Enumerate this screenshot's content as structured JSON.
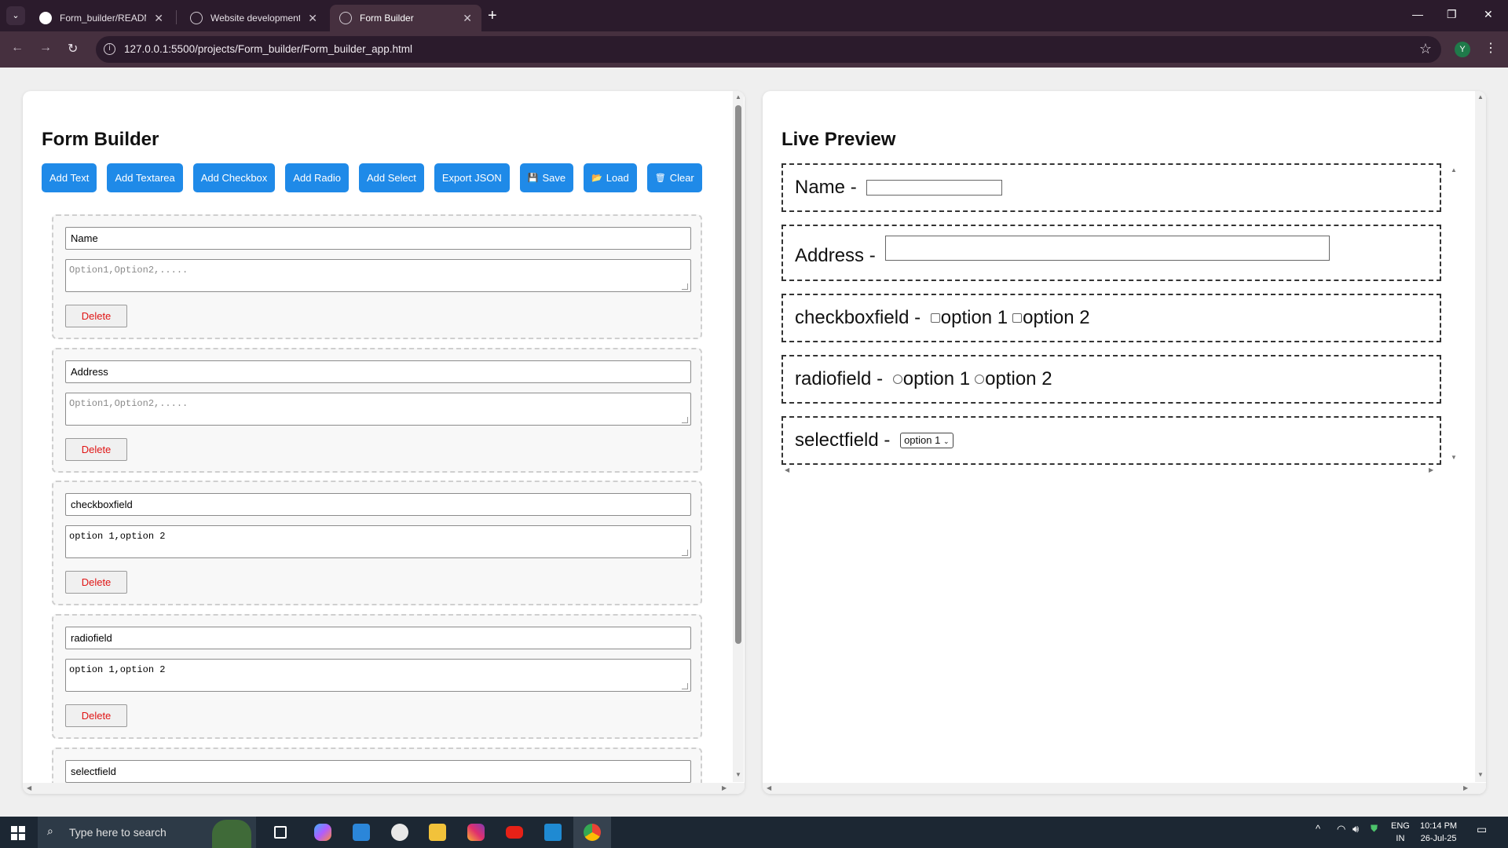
{
  "browser": {
    "tabs": [
      {
        "title": "Form_builder/README.md at m"
      },
      {
        "title": "Website development request"
      },
      {
        "title": "Form Builder"
      }
    ],
    "url": "127.0.0.1:5500/projects/Form_builder/Form_builder_app.html",
    "profile_initial": "Y"
  },
  "builder": {
    "title": "Form Builder",
    "buttons": {
      "add_text": "Add Text",
      "add_textarea": "Add Textarea",
      "add_checkbox": "Add Checkbox",
      "add_radio": "Add Radio",
      "add_select": "Add Select",
      "export_json": "Export JSON",
      "save": "Save",
      "load": "Load",
      "clear": "Clear"
    },
    "options_placeholder": "Option1,Option2,.....",
    "delete_label": "Delete",
    "fields": [
      {
        "label": "Name",
        "options": ""
      },
      {
        "label": "Address",
        "options": ""
      },
      {
        "label": "checkboxfield",
        "options": "option 1,option 2"
      },
      {
        "label": "radiofield",
        "options": "option 1,option 2"
      },
      {
        "label": "selectfield",
        "options": ""
      }
    ]
  },
  "preview": {
    "title": "Live Preview",
    "separator": " - ",
    "name_label": "Name",
    "address_label": "Address",
    "checkbox_label": "checkboxfield",
    "checkbox_options": [
      "option 1",
      "option 2"
    ],
    "radio_label": "radiofield",
    "radio_options": [
      "option 1",
      "option 2"
    ],
    "select_label": "selectfield",
    "select_value": "option 1"
  },
  "taskbar": {
    "search_placeholder": "Type here to search",
    "lang_1": "ENG",
    "lang_2": "IN",
    "time": "10:14 PM",
    "date": "26-Jul-25"
  }
}
